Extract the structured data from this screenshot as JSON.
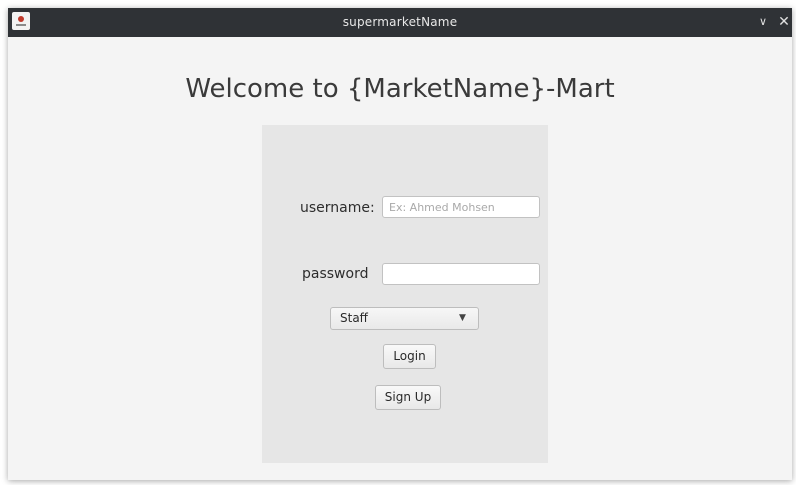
{
  "window": {
    "title": "supermarketName",
    "icons": {
      "app": "app-logo-icon",
      "minimize": "chevron-down-icon",
      "close": "close-icon"
    },
    "minimize_glyph": "∨",
    "close_glyph": "✕"
  },
  "main": {
    "heading": "Welcome to {MarketName}-Mart"
  },
  "form": {
    "username_label": "username:",
    "username_placeholder": "Ex: Ahmed Mohsen",
    "username_value": "",
    "password_label": "password",
    "password_value": "",
    "role_selected": "Staff",
    "role_dropdown_icon": "triangle-down-icon",
    "login_label": "Login",
    "signup_label": "Sign Up"
  },
  "colors": {
    "titlebar": "#2f3236",
    "window_bg": "#f4f4f4",
    "panel_bg": "#e6e6e6"
  }
}
